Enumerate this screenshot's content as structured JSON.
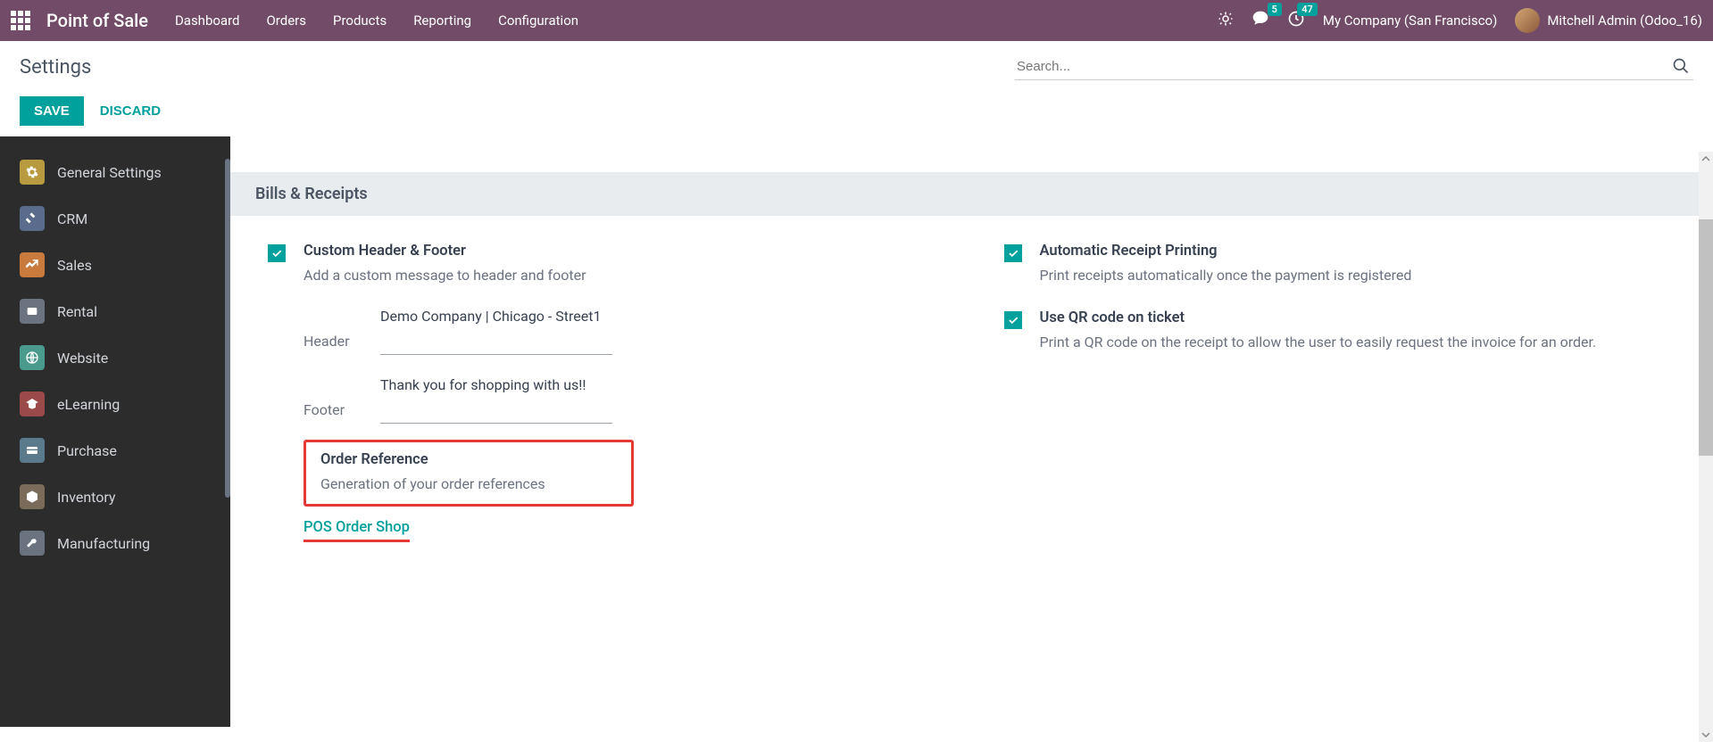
{
  "topbar": {
    "app_name": "Point of Sale",
    "nav": [
      "Dashboard",
      "Orders",
      "Products",
      "Reporting",
      "Configuration"
    ],
    "messages_badge": "5",
    "activities_badge": "47",
    "company": "My Company (San Francisco)",
    "user": "Mitchell Admin (Odoo_16)"
  },
  "subheader": {
    "title": "Settings",
    "search_placeholder": "Search...",
    "save": "SAVE",
    "discard": "DISCARD"
  },
  "sidebar": {
    "items": [
      {
        "label": "General Settings",
        "bg": "#b89b3e"
      },
      {
        "label": "CRM",
        "bg": "#5b6b8c"
      },
      {
        "label": "Sales",
        "bg": "#c97b3e"
      },
      {
        "label": "Rental",
        "bg": "#6b7280"
      },
      {
        "label": "Website",
        "bg": "#4a9b8e"
      },
      {
        "label": "eLearning",
        "bg": "#9b4a4a"
      },
      {
        "label": "Purchase",
        "bg": "#5b7a8c"
      },
      {
        "label": "Inventory",
        "bg": "#7a6b5b"
      },
      {
        "label": "Manufacturing",
        "bg": "#6b7280"
      }
    ]
  },
  "section": {
    "header": "Bills & Receipts"
  },
  "settings": {
    "custom_header": {
      "title": "Custom Header & Footer",
      "desc": "Add a custom message to header and footer",
      "header_label": "Header",
      "header_value": "Demo Company | Chicago - Street1",
      "footer_label": "Footer",
      "footer_value": "Thank you for shopping with us!!"
    },
    "order_ref": {
      "title": "Order Reference",
      "desc": "Generation of your order references",
      "link": "POS Order Shop"
    },
    "auto_receipt": {
      "title": "Automatic Receipt Printing",
      "desc": "Print receipts automatically once the payment is registered"
    },
    "qr_code": {
      "title": "Use QR code on ticket",
      "desc": "Print a QR code on the receipt to allow the user to easily request the invoice for an order."
    }
  }
}
